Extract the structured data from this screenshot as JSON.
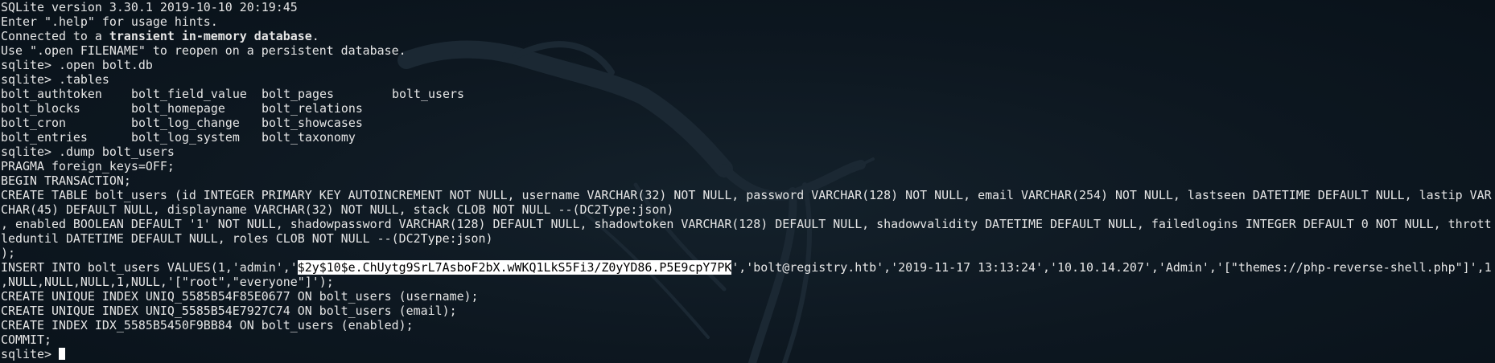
{
  "terminal": {
    "banner": {
      "version": "SQLite version 3.30.1 2019-10-10 20:19:45",
      "help": "Enter \".help\" for usage hints.",
      "connected_prefix": "Connected to a ",
      "connected_bold": "transient in-memory database",
      "connected_suffix": ".",
      "reopen": "Use \".open FILENAME\" to reopen on a persistent database."
    },
    "prompt": "sqlite> ",
    "cmd_open": ".open bolt.db",
    "cmd_tables": ".tables",
    "tables": [
      [
        "bolt_authtoken",
        "bolt_field_value",
        "bolt_pages",
        "bolt_users"
      ],
      [
        "bolt_blocks",
        "bolt_homepage",
        "bolt_relations",
        ""
      ],
      [
        "bolt_cron",
        "bolt_log_change",
        "bolt_showcases",
        ""
      ],
      [
        "bolt_entries",
        "bolt_log_system",
        "bolt_taxonomy",
        ""
      ]
    ],
    "cmd_dump": ".dump bolt_users",
    "dump": {
      "pragma": "PRAGMA foreign_keys=OFF;",
      "begin": "BEGIN TRANSACTION;",
      "create_1": "CREATE TABLE bolt_users (id INTEGER PRIMARY KEY AUTOINCREMENT NOT NULL, username VARCHAR(32) NOT NULL, password VARCHAR(128) NOT NULL, email VARCHAR(254) NOT NULL, lastseen DATETIME DEFAULT NULL, lastip VAR",
      "create_2": "CHAR(45) DEFAULT NULL, displayname VARCHAR(32) NOT NULL, stack CLOB NOT NULL --(DC2Type:json)",
      "create_3": ", enabled BOOLEAN DEFAULT '1' NOT NULL, shadowpassword VARCHAR(128) DEFAULT NULL, shadowtoken VARCHAR(128) DEFAULT NULL, shadowvalidity DATETIME DEFAULT NULL, failedlogins INTEGER DEFAULT 0 NOT NULL, thrott",
      "create_4": "leduntil DATETIME DEFAULT NULL, roles CLOB NOT NULL --(DC2Type:json)",
      "create_end": ");",
      "insert_prefix": "INSERT INTO bolt_users VALUES(1,'admin','",
      "insert_hash": "$2y$10$e.ChUytg9SrL7AsboF2bX.wWKQ1LkS5Fi3/Z0yYD86.P5E9cpY7PK",
      "insert_suffix": "','bolt@registry.htb','2019-11-17 13:13:24','10.10.14.207','Admin','[\"themes://php-reverse-shell.php\"]',1",
      "insert_cont": ",NULL,NULL,NULL,1,NULL,'[\"root\",\"everyone\"]');",
      "index_1": "CREATE UNIQUE INDEX UNIQ_5585B54F85E0677 ON bolt_users (username);",
      "index_2": "CREATE UNIQUE INDEX UNIQ_5585B54E7927C74 ON bolt_users (email);",
      "index_3": "CREATE INDEX IDX_5585B5450F9BB84 ON bolt_users (enabled);",
      "commit": "COMMIT;"
    },
    "colors": {
      "background": "#0b141c",
      "text": "#e6e6e6",
      "selection_bg": "#ffffff",
      "selection_fg": "#000000"
    },
    "background_icon": "kali-dragon-icon"
  }
}
